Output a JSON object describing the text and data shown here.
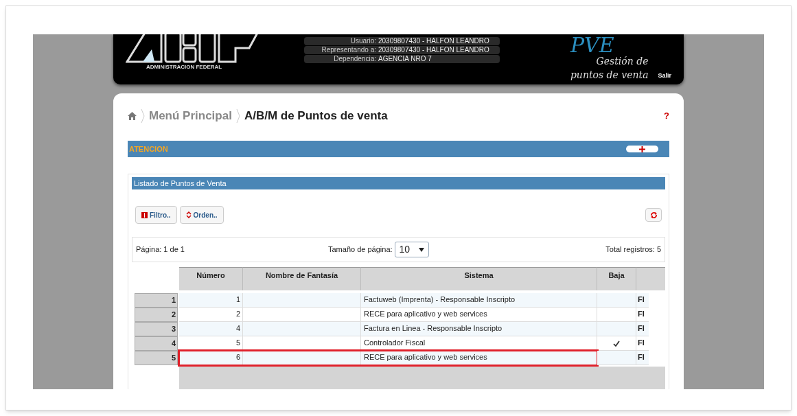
{
  "header": {
    "logo_caption": "ADMINISTRACION FEDERAL",
    "user_info": [
      {
        "label": "Usuario:",
        "value": "20309807430 - HALFON LEANDRO"
      },
      {
        "label": "Representando a:",
        "value": "20309807430 - HALFON LEANDRO"
      },
      {
        "label": "Dependencia:",
        "value": "AGENCIA NRO 7"
      }
    ],
    "app_name": "PVE",
    "app_subtitle": [
      "Gestión de",
      "puntos de venta"
    ],
    "logout": "Salir"
  },
  "breadcrumb": [
    {
      "label": "Menú Principal",
      "selected": false
    },
    {
      "label": "A/B/M de Puntos de venta",
      "selected": true
    }
  ],
  "help": "?",
  "attention_bar": {
    "title": "ATENCION",
    "expanded": false
  },
  "list_panel": {
    "title": "Listado de Puntos de Venta",
    "buttons": [
      "Filtro..",
      "Orden.."
    ],
    "pager": {
      "page": "Página: 1 de 1",
      "page_size_label": "Tamaño de página:",
      "page_size": "10",
      "total": "Total registros: 5"
    },
    "table": {
      "columns": [
        "Número",
        "Nombre de Fantasía",
        "Sistema",
        "Baja"
      ],
      "rows": [
        {
          "index": "1",
          "numero": "1",
          "nombre": "",
          "sistema": "Factuweb (Imprenta) - Responsable Inscripto",
          "baja": false,
          "column_5": "FI",
          "highlighted": false
        },
        {
          "index": "2",
          "numero": "2",
          "nombre": "",
          "sistema": "RECE para aplicativo y web services",
          "baja": false,
          "column_5": "FI",
          "highlighted": false
        },
        {
          "index": "3",
          "numero": "4",
          "nombre": "",
          "sistema": "Factura en Linea - Responsable Inscripto",
          "baja": false,
          "column_5": "FI",
          "highlighted": false
        },
        {
          "index": "4",
          "numero": "5",
          "nombre": "",
          "sistema": "Controlador Fiscal",
          "baja": true,
          "column_5": "FI",
          "highlighted": false
        },
        {
          "index": "5",
          "numero": "6",
          "nombre": "",
          "sistema": "RECE para aplicativo y web services",
          "baja": false,
          "column_5": "FI",
          "highlighted": true
        }
      ]
    }
  }
}
